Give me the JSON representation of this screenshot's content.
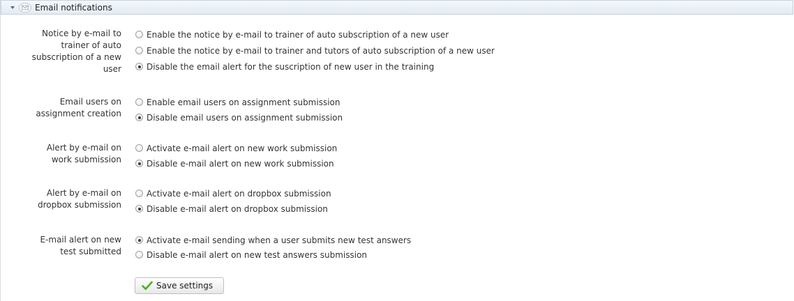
{
  "panel": {
    "title": "Email notifications",
    "collapse_icon": "chevron-down-icon",
    "header_icon": "envelope-icon"
  },
  "settings": [
    {
      "label": "Notice by e-mail to trainer of auto subscription of a new user",
      "label_lines": [
        "Notice by e-mail to",
        "trainer of auto",
        "subscription of a new",
        "user"
      ],
      "options": [
        {
          "label": "Enable the notice by e-mail to trainer of auto subscription of a new user",
          "checked": false
        },
        {
          "label": "Enable the notice by e-mail to trainer and tutors of auto subscription of a new user",
          "checked": false
        },
        {
          "label": "Disable the email alert for the suscription of new user in the training",
          "checked": true
        }
      ]
    },
    {
      "label": "Email users on assignment creation",
      "label_lines": [
        "Email users on",
        "assignment creation"
      ],
      "options": [
        {
          "label": "Enable email users on assignment submission",
          "checked": false
        },
        {
          "label": "Disable email users on assignment submission",
          "checked": true
        }
      ]
    },
    {
      "label": "Alert by e-mail on work submission",
      "label_lines": [
        "Alert by e-mail on",
        "work submission"
      ],
      "options": [
        {
          "label": "Activate e-mail alert on new work submission",
          "checked": false
        },
        {
          "label": "Disable e-mail alert on new work submission",
          "checked": true
        }
      ]
    },
    {
      "label": "Alert by e-mail on dropbox submission",
      "label_lines": [
        "Alert by e-mail on",
        "dropbox submission"
      ],
      "options": [
        {
          "label": "Activate e-mail alert on dropbox submission",
          "checked": false
        },
        {
          "label": "Disable e-mail alert on dropbox submission",
          "checked": true
        }
      ]
    },
    {
      "label": "E-mail alert on new test submitted",
      "label_lines": [
        "E-mail alert on new",
        "test submitted"
      ],
      "options": [
        {
          "label": "Activate e-mail sending when a user submits new test answers",
          "checked": true
        },
        {
          "label": "Disable e-mail alert on new test answers submission",
          "checked": false
        }
      ]
    }
  ],
  "save_button": {
    "label": "Save settings",
    "icon": "checkmark-icon"
  },
  "colors": {
    "header_bg": "#e3ebf4",
    "header_border": "#c5d1de",
    "check_green": "#4caf1f"
  }
}
